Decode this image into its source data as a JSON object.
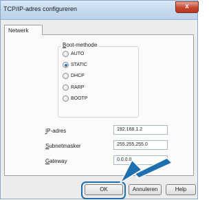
{
  "window": {
    "title": "TCP/IP-adres configureren",
    "close_label": "x"
  },
  "tabs": [
    {
      "label": "Netwerk"
    }
  ],
  "boot_method": {
    "legend_first": "B",
    "legend_rest": "oot-methode",
    "options": [
      {
        "label": "AUTO",
        "checked": false
      },
      {
        "label": "STATIC",
        "checked": true
      },
      {
        "label": "DHCP",
        "checked": false
      },
      {
        "label": "RARP",
        "checked": false
      },
      {
        "label": "BOOTP",
        "checked": false
      }
    ]
  },
  "fields": {
    "ip": {
      "label_first": "I",
      "label_rest": "P-adres",
      "value": "192.168.1.2"
    },
    "subnet": {
      "label_first": "S",
      "label_rest": "ubnetmasker",
      "value": "255.255.255.0"
    },
    "gateway": {
      "label_first": "G",
      "label_rest": "ateway",
      "value": "0.0.0.0"
    }
  },
  "buttons": {
    "ok": "OK",
    "cancel": "Annuleren",
    "help": "Help"
  },
  "colors": {
    "accent": "#1e6fb0",
    "titlebar": "#c5d8ee",
    "close": "#c7462c"
  },
  "icons": {
    "radio_button": "radio-icon",
    "pointer_arrow": "arrow-pointer-icon"
  }
}
